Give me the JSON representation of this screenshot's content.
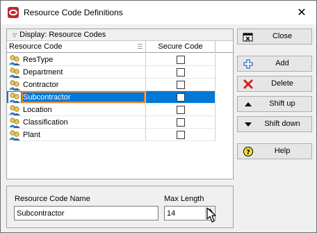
{
  "window": {
    "title": "Resource Code Definitions",
    "close_glyph": "✕"
  },
  "list": {
    "display_label": "Display: Resource Codes",
    "columns": {
      "code": "Resource Code",
      "secure": "Secure Code"
    },
    "rows": [
      {
        "label": "ResType",
        "secure": false,
        "selected": false
      },
      {
        "label": "Department",
        "secure": false,
        "selected": false
      },
      {
        "label": "Contractor",
        "secure": false,
        "selected": false
      },
      {
        "label": "Subcontractor",
        "secure": false,
        "selected": true
      },
      {
        "label": "Location",
        "secure": false,
        "selected": false
      },
      {
        "label": "Classification",
        "secure": false,
        "selected": false
      },
      {
        "label": "Plant",
        "secure": false,
        "selected": false
      }
    ]
  },
  "buttons": {
    "close": "Close",
    "add": "Add",
    "delete": "Delete",
    "shift_up": "Shift up",
    "shift_down": "Shift down",
    "help": "Help"
  },
  "form": {
    "name_label": "Resource Code Name",
    "name_value": "Subcontractor",
    "max_label": "Max Length",
    "max_value": "14"
  },
  "colors": {
    "selection": "#0078d7",
    "focus_border": "#e8822e",
    "app_icon": "#c0282d"
  }
}
